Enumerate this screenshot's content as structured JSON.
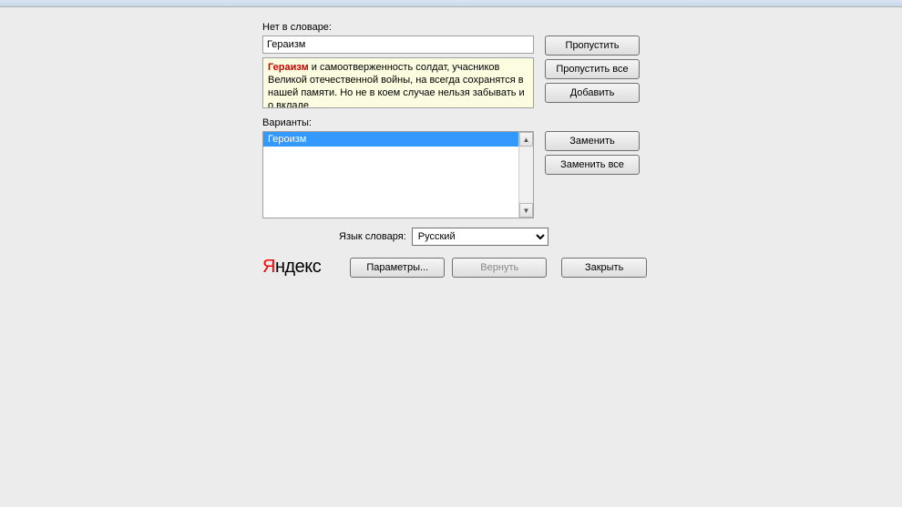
{
  "labels": {
    "not_in_dict": "Нет в словаре:",
    "variants": "Варианты:",
    "dict_language": "Язык словаря:"
  },
  "fields": {
    "word": "Гераизм",
    "context_misspelled": "Гераизм",
    "context_rest": " и самоотверженность солдат, учасников Великой отечественной войны, на всегда сохранятся в нашей памяти. Но не в коем случае нельзя забывать и о вкладе"
  },
  "variants": {
    "items": [
      "Героизм"
    ],
    "selected_index": 0
  },
  "language": {
    "selected": "Русский"
  },
  "buttons": {
    "skip": "Пропустить",
    "skip_all": "Пропустить все",
    "add": "Добавить",
    "replace": "Заменить",
    "replace_all": "Заменить все",
    "params": "Параметры...",
    "revert": "Вернуть",
    "close": "Закрыть"
  },
  "logo": {
    "first": "Я",
    "rest": "ндекс"
  }
}
